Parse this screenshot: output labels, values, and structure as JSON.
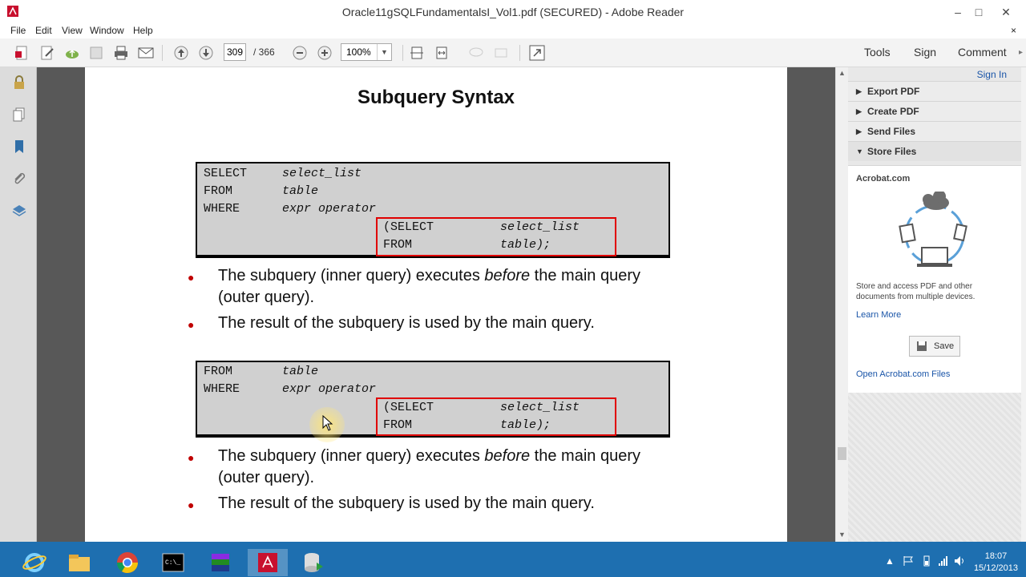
{
  "window": {
    "title": "Oracle11gSQLFundamentalsI_Vol1.pdf (SECURED) - Adobe Reader",
    "minimize": "–",
    "maximize": "□",
    "close": "✕"
  },
  "menu": {
    "items": [
      "File",
      "Edit",
      "View",
      "Window",
      "Help"
    ],
    "close": "×"
  },
  "toolbar": {
    "page_current": "309",
    "page_total": "/ 366",
    "zoom": "100%",
    "tools": "Tools",
    "sign": "Sign",
    "comment": "Comment"
  },
  "slide": {
    "title": "Subquery Syntax",
    "code": {
      "select_kw": "SELECT",
      "select_val": "select_list",
      "from_kw": "FROM",
      "from_val": "table",
      "where_kw": "WHERE",
      "where_val": "expr operator",
      "sub_select_kw": "(SELECT",
      "sub_select_val": "select_list",
      "sub_from_kw": "FROM",
      "sub_from_val": "table);"
    },
    "bullet1_pre": "The subquery (inner query) executes ",
    "bullet1_em": "before",
    "bullet1_post": " the main query (outer query).",
    "bullet2": "The result of the subquery is used by the main query."
  },
  "right_panel": {
    "sign_in": "Sign In",
    "sections": [
      "Export PDF",
      "Create PDF",
      "Send Files",
      "Store Files"
    ],
    "acrobat_title": "Acrobat.com",
    "description": "Store and access PDF and other documents from multiple devices.",
    "learn_more": "Learn More",
    "save": "Save",
    "open_files": "Open Acrobat.com Files"
  },
  "taskbar": {
    "time": "18:07",
    "date": "15/12/2013"
  },
  "colors": {
    "accent": "#1e6fb0",
    "code_bg": "#d0d0d0",
    "highlight": "#e00000"
  }
}
